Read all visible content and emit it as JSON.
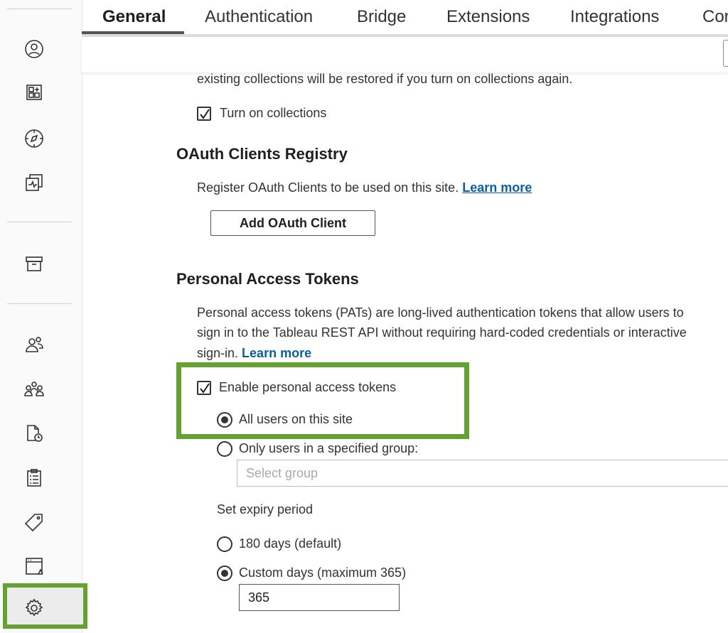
{
  "tabs": [
    "General",
    "Authentication",
    "Bridge",
    "Extensions",
    "Integrations",
    "Cor"
  ],
  "colors": {
    "highlight": "#63a230",
    "link": "#0b5fa0"
  },
  "sidebar": {
    "icons": [
      "user-icon",
      "add-content-icon",
      "explore-icon",
      "recents-icon",
      "archive-icon",
      "users-icon",
      "groups-icon",
      "schedule-icon",
      "tasks-icon",
      "tag-icon",
      "site-status-icon",
      "gear-icon"
    ]
  },
  "collections": {
    "note": "existing collections will be restored if you turn on collections again.",
    "checkbox_label": "Turn on collections",
    "checked": true
  },
  "oauth": {
    "title": "OAuth Clients Registry",
    "desc": "Register OAuth Clients to be used on this site.",
    "learn_more": "Learn more",
    "button": "Add OAuth Client"
  },
  "pat": {
    "title": "Personal Access Tokens",
    "desc_line1": "Personal access tokens (PATs) are long-lived authentication tokens that allow users to",
    "desc_line2": "sign in to the Tableau REST API without requiring hard-coded credentials or interactive",
    "desc_line3": "sign-in.",
    "learn_more": "Learn more",
    "enable_label": "Enable personal access tokens",
    "enable_checked": true,
    "option_all": "All users on this site",
    "option_group": "Only users in a specified group:",
    "selected_option": "All users on this site",
    "group_placeholder": "Select group",
    "expiry_title": "Set expiry period",
    "expiry_default": "180 days (default)",
    "expiry_custom": "Custom days (maximum 365)",
    "selected_expiry": "Custom days (maximum 365)",
    "custom_days_value": "365"
  }
}
